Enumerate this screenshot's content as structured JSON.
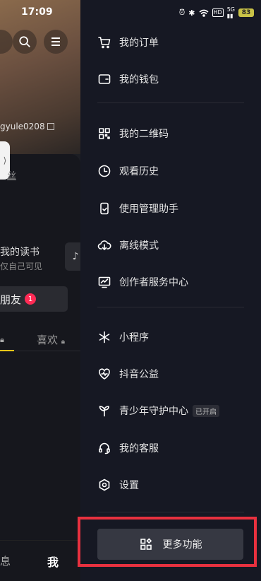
{
  "status": {
    "time": "17:09",
    "hd": "HD",
    "net": "5G",
    "battery": "83"
  },
  "profile": {
    "user_id": "gyule0208",
    "fans_label": "丝",
    "reading_title": "我的读书",
    "reading_sub": "仅自己可见",
    "add_friend": "朋友",
    "friend_badge": "1",
    "tab_like": "喜欢",
    "nav_messages": "息",
    "nav_me": "我"
  },
  "menu": {
    "orders": "我的订单",
    "wallet": "我的钱包",
    "qrcode": "我的二维码",
    "history": "观看历史",
    "usage_helper": "使用管理助手",
    "offline": "离线模式",
    "creator_center": "创作者服务中心",
    "mini_programs": "小程序",
    "charity": "抖音公益",
    "youth_guard": "青少年守护中心",
    "youth_guard_tag": "已开启",
    "support": "我的客服",
    "settings": "设置",
    "more": "更多功能"
  }
}
